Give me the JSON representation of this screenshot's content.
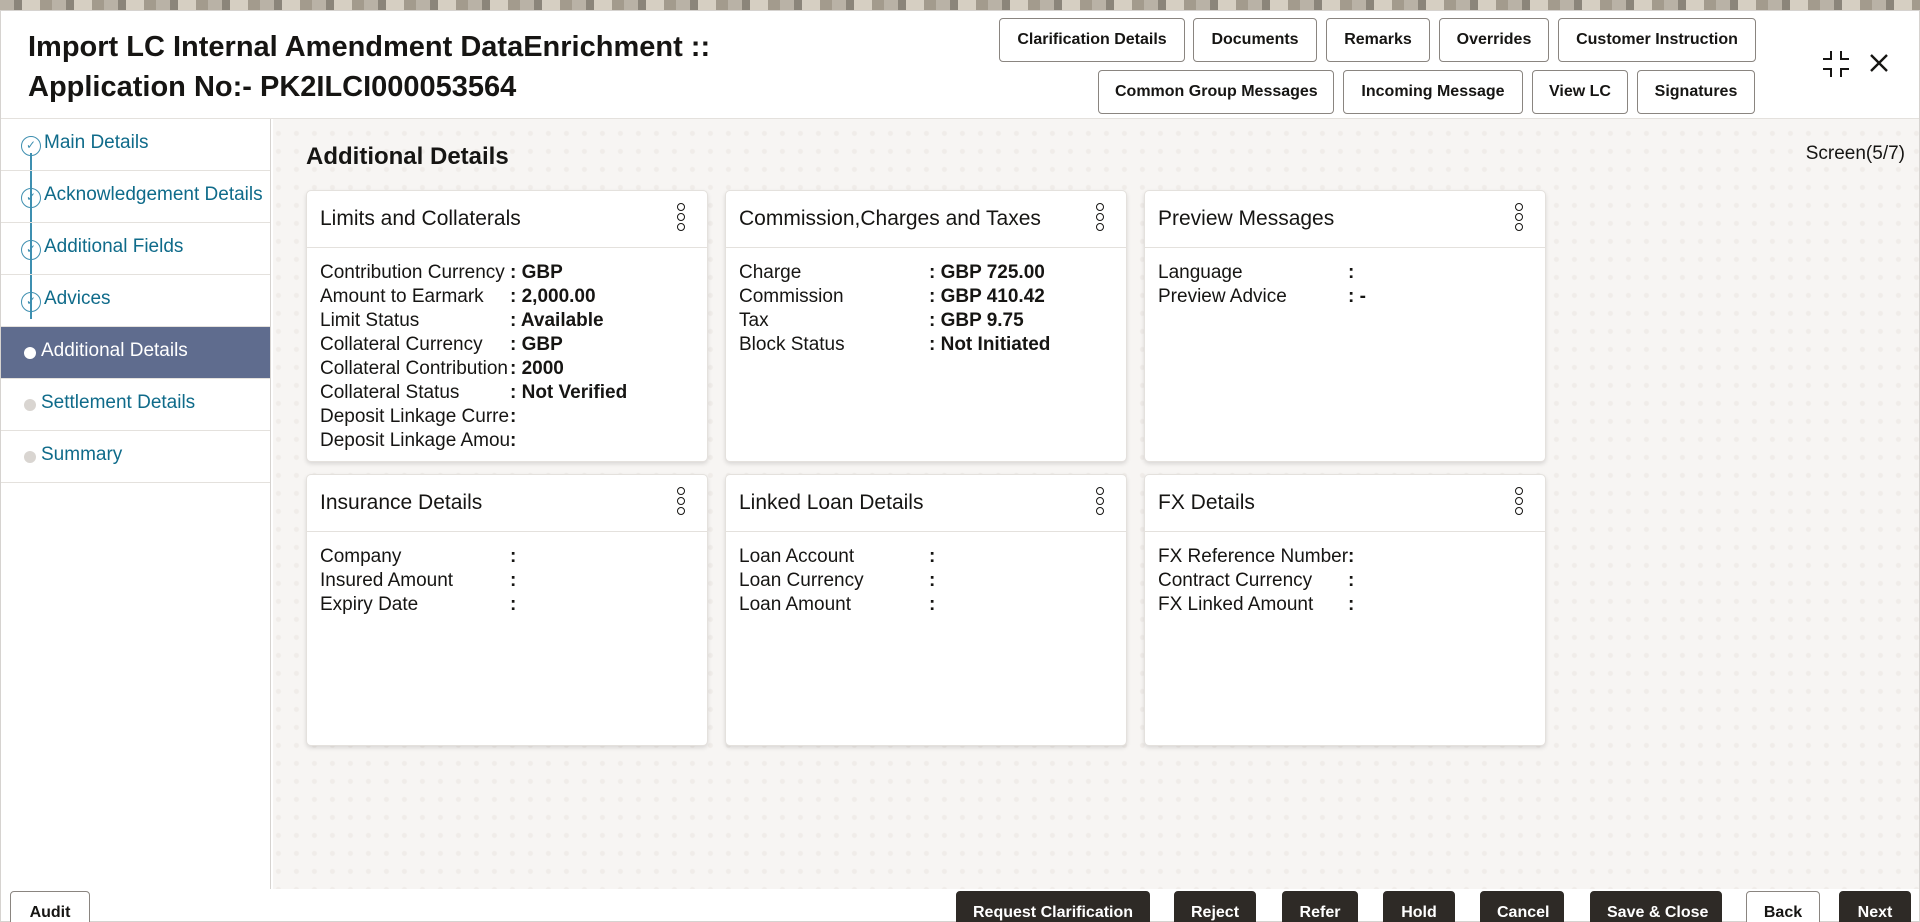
{
  "title": {
    "line1": "Import LC Internal Amendment DataEnrichment ::",
    "line2": "Application No:- PK2ILCI000053564"
  },
  "header_buttons_row1": [
    "Clarification Details",
    "Documents",
    "Remarks",
    "Overrides",
    "Customer Instruction"
  ],
  "header_buttons_row2": [
    "Common Group Messages",
    "Incoming Message",
    "View LC",
    "Signatures"
  ],
  "window_controls": {
    "minimize_icon": "compress-icon",
    "close_icon": "close-icon"
  },
  "sidebar": {
    "items": [
      {
        "label": "Main Details",
        "state": "done"
      },
      {
        "label": "Acknowledgement Details",
        "state": "done"
      },
      {
        "label": "Additional Fields",
        "state": "done"
      },
      {
        "label": "Advices",
        "state": "done"
      },
      {
        "label": "Additional Details",
        "state": "active"
      },
      {
        "label": "Settlement Details",
        "state": "pending"
      },
      {
        "label": "Summary",
        "state": "pending"
      }
    ]
  },
  "main": {
    "title": "Additional Details",
    "screen_indicator": "Screen(5/7)",
    "cards": [
      {
        "title": "Limits and Collaterals",
        "rows": [
          {
            "key": "Contribution Currency",
            "value": ": GBP"
          },
          {
            "key": "Amount to Earmark",
            "value": ": 2,000.00"
          },
          {
            "key": "Limit Status",
            "value": ": Available"
          },
          {
            "key": "Collateral Currency",
            "value": ": GBP"
          },
          {
            "key": "Collateral Contribution",
            "value": ": 2000"
          },
          {
            "key": "Collateral Status",
            "value": ": Not Verified"
          },
          {
            "key": "Deposit Linkage Currency",
            "value": ":"
          },
          {
            "key": "Deposit Linkage Amount",
            "value": ":"
          }
        ]
      },
      {
        "title": "Commission,Charges and Taxes",
        "rows": [
          {
            "key": "Charge",
            "value": ": GBP  725.00"
          },
          {
            "key": "Commission",
            "value": ": GBP  410.42"
          },
          {
            "key": "Tax",
            "value": ": GBP  9.75"
          },
          {
            "key": "Block Status",
            "value": ": Not Initiated"
          }
        ]
      },
      {
        "title": "Preview Messages",
        "rows": [
          {
            "key": "Language",
            "value": ":"
          },
          {
            "key": "Preview Advice",
            "value": ": -"
          }
        ]
      },
      {
        "title": "Insurance Details",
        "rows": [
          {
            "key": "Company",
            "value": ":"
          },
          {
            "key": "Insured Amount",
            "value": ":"
          },
          {
            "key": "Expiry Date",
            "value": ":"
          }
        ]
      },
      {
        "title": "Linked Loan Details",
        "rows": [
          {
            "key": "Loan Account",
            "value": ":"
          },
          {
            "key": "Loan Currency",
            "value": ":"
          },
          {
            "key": "Loan Amount",
            "value": ":"
          }
        ]
      },
      {
        "title": "FX Details",
        "rows": [
          {
            "key": "FX Reference Number",
            "value": ":"
          },
          {
            "key": "Contract Currency",
            "value": ":"
          },
          {
            "key": "FX Linked Amount",
            "value": ":"
          }
        ]
      }
    ]
  },
  "footer": {
    "audit": "Audit",
    "buttons": [
      "Request Clarification",
      "Reject",
      "Refer",
      "Hold",
      "Cancel",
      "Save & Close",
      "Back",
      "Next"
    ]
  }
}
